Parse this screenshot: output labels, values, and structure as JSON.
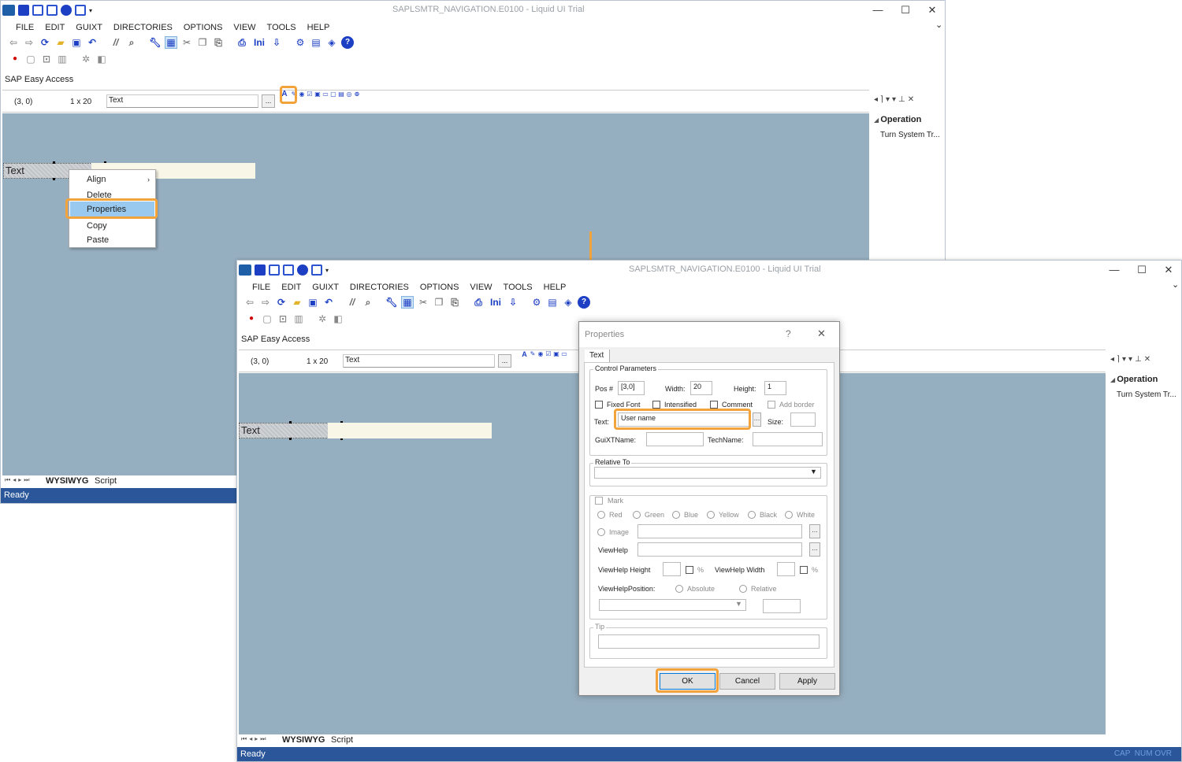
{
  "window": {
    "title": "SAPLSMTR_NAVIGATION.E0100 - Liquid UI Trial",
    "min": "—",
    "max": "☐",
    "close": "✕",
    "collapse": "⌄"
  },
  "menu": [
    "FILE",
    "EDIT",
    "GUIXT",
    "DIRECTORIES",
    "OPTIONS",
    "VIEW",
    "TOOLS",
    "HELP"
  ],
  "toolbar": {
    "ini_label": "Ini"
  },
  "panel_title": "SAP Easy Access",
  "infobar": {
    "pos": "(3, 0)",
    "size": "1 x 20",
    "text": "Text",
    "dots": "..."
  },
  "element_label": "Text",
  "context_menu": [
    "Align",
    "Delete",
    "Properties",
    "Copy",
    "Paste"
  ],
  "side_panel": {
    "heading": "Operation",
    "item": "Turn System Tr..."
  },
  "bottom_tabs": [
    "WYSIWYG",
    "Script"
  ],
  "status": "Ready",
  "status_indicators": "CAP  NUM OVR",
  "dialog": {
    "title": "Properties",
    "help": "?",
    "close": "✕",
    "tab": "Text",
    "control_params": "Control Parameters",
    "pos_label": "Pos #",
    "pos_value": "[3,0]",
    "width_label": "Width:",
    "width_value": "20",
    "height_label": "Height:",
    "height_value": "1",
    "fixed_font": "Fixed Font",
    "intensified": "Intensified",
    "comment": "Comment",
    "add_border": "Add border",
    "text_label": "Text:",
    "text_value": "User name",
    "size_label": "Size:",
    "guixtname_label": "GuiXTName:",
    "techname_label": "TechName:",
    "relative_to": "Relative To",
    "mark": "Mark",
    "colors": [
      "Red",
      "Green",
      "Blue",
      "Yellow",
      "Black",
      "White"
    ],
    "image": "Image",
    "viewhelp": "ViewHelp",
    "vh_height": "ViewHelp Height",
    "vh_width": "ViewHelp Width",
    "percent": "%",
    "vh_position": "ViewHelpPosition:",
    "absolute": "Absolute",
    "relative": "Relative",
    "tip": "Tip",
    "ok": "OK",
    "cancel": "Cancel",
    "apply": "Apply"
  },
  "colors": {
    "accent": "#f3a33b",
    "canvas": "#96afc0",
    "status": "#2b579a",
    "menu_highlight": "#99c9ef"
  }
}
